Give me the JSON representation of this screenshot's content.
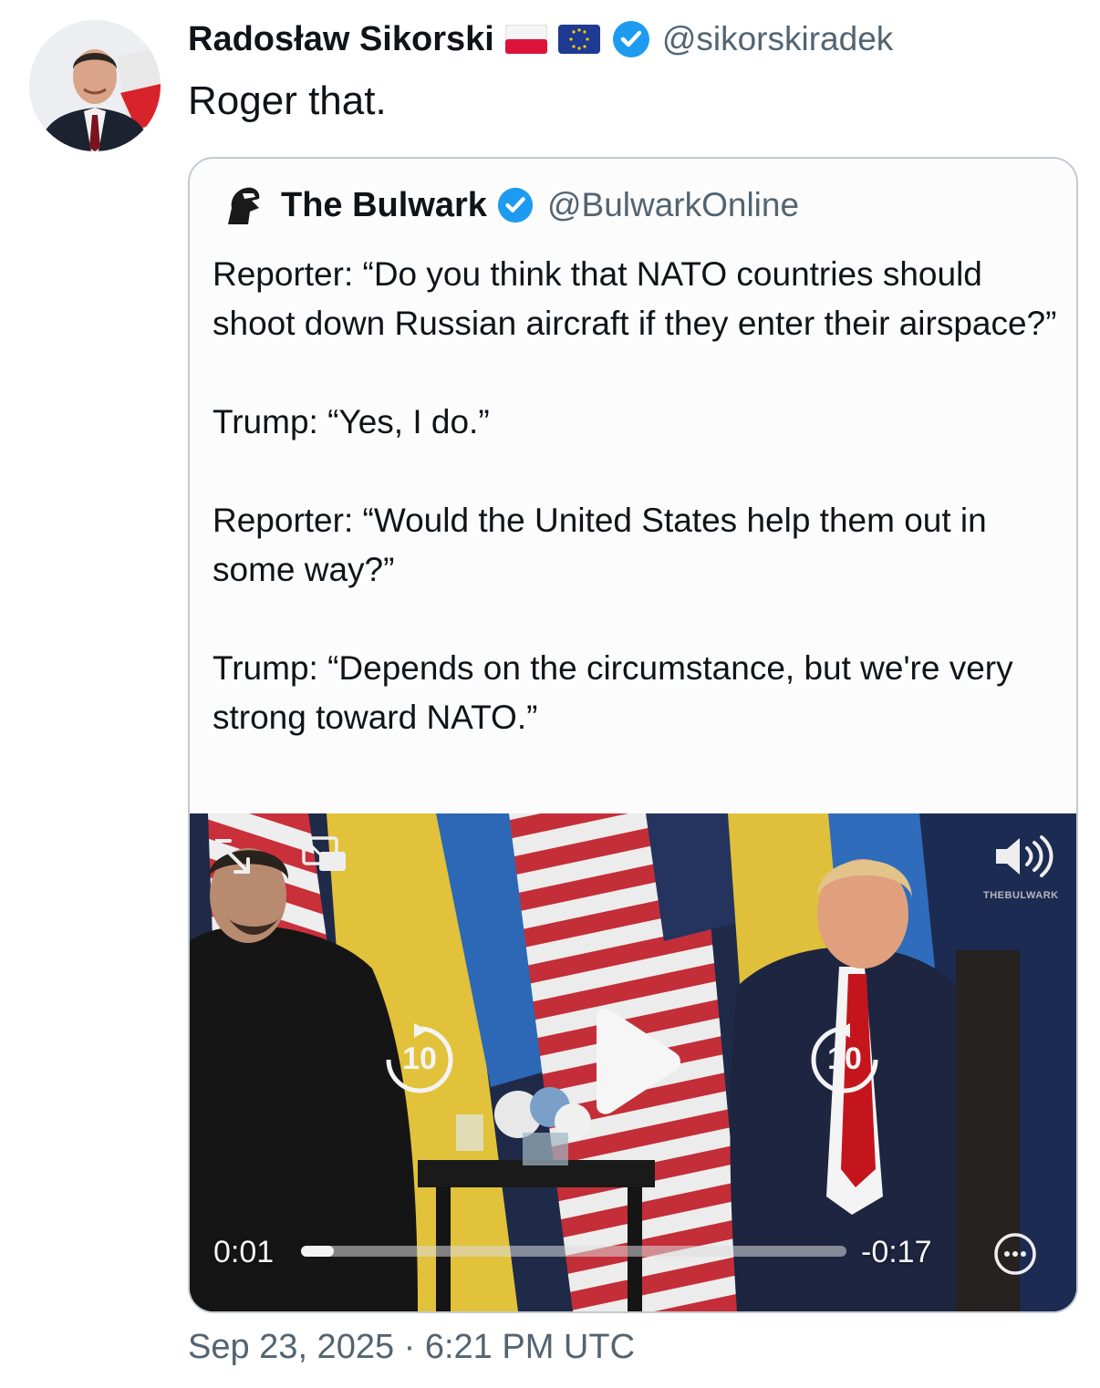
{
  "post": {
    "author_name": "Radosław Sikorski",
    "author_flags": [
      "poland-flag-icon",
      "eu-flag-icon"
    ],
    "verified": true,
    "author_handle": "@sikorskiradek",
    "text": "Roger that.",
    "timestamp": "Sep 23, 2025 · 6:21 PM UTC"
  },
  "quoted": {
    "author_name": "The Bulwark",
    "verified": true,
    "author_handle": "@BulwarkOnline",
    "paragraphs": [
      "Reporter: “Do you think that NATO countries should shoot down Russian aircraft if they enter their airspace?”",
      "Trump: “Yes, I do.”",
      "Reporter: “Would the United States help them out in some way?”",
      "Trump: “Depends on the circumstance, but we're very strong toward NATO.”"
    ]
  },
  "video": {
    "elapsed": "0:01",
    "remaining": "-0:17",
    "progress": 0.06,
    "skip_back_label": "10",
    "skip_forward_label": "10",
    "watermark": "THEBULWARK",
    "icons": [
      "expand-icon",
      "picture-in-picture-icon",
      "volume-icon",
      "rewind-10-icon",
      "play-icon",
      "forward-10-icon",
      "more-options-icon"
    ]
  },
  "colors": {
    "verified_blue": "#1d9bf0",
    "secondary_text": "#536471",
    "border": "#c3cad1"
  }
}
